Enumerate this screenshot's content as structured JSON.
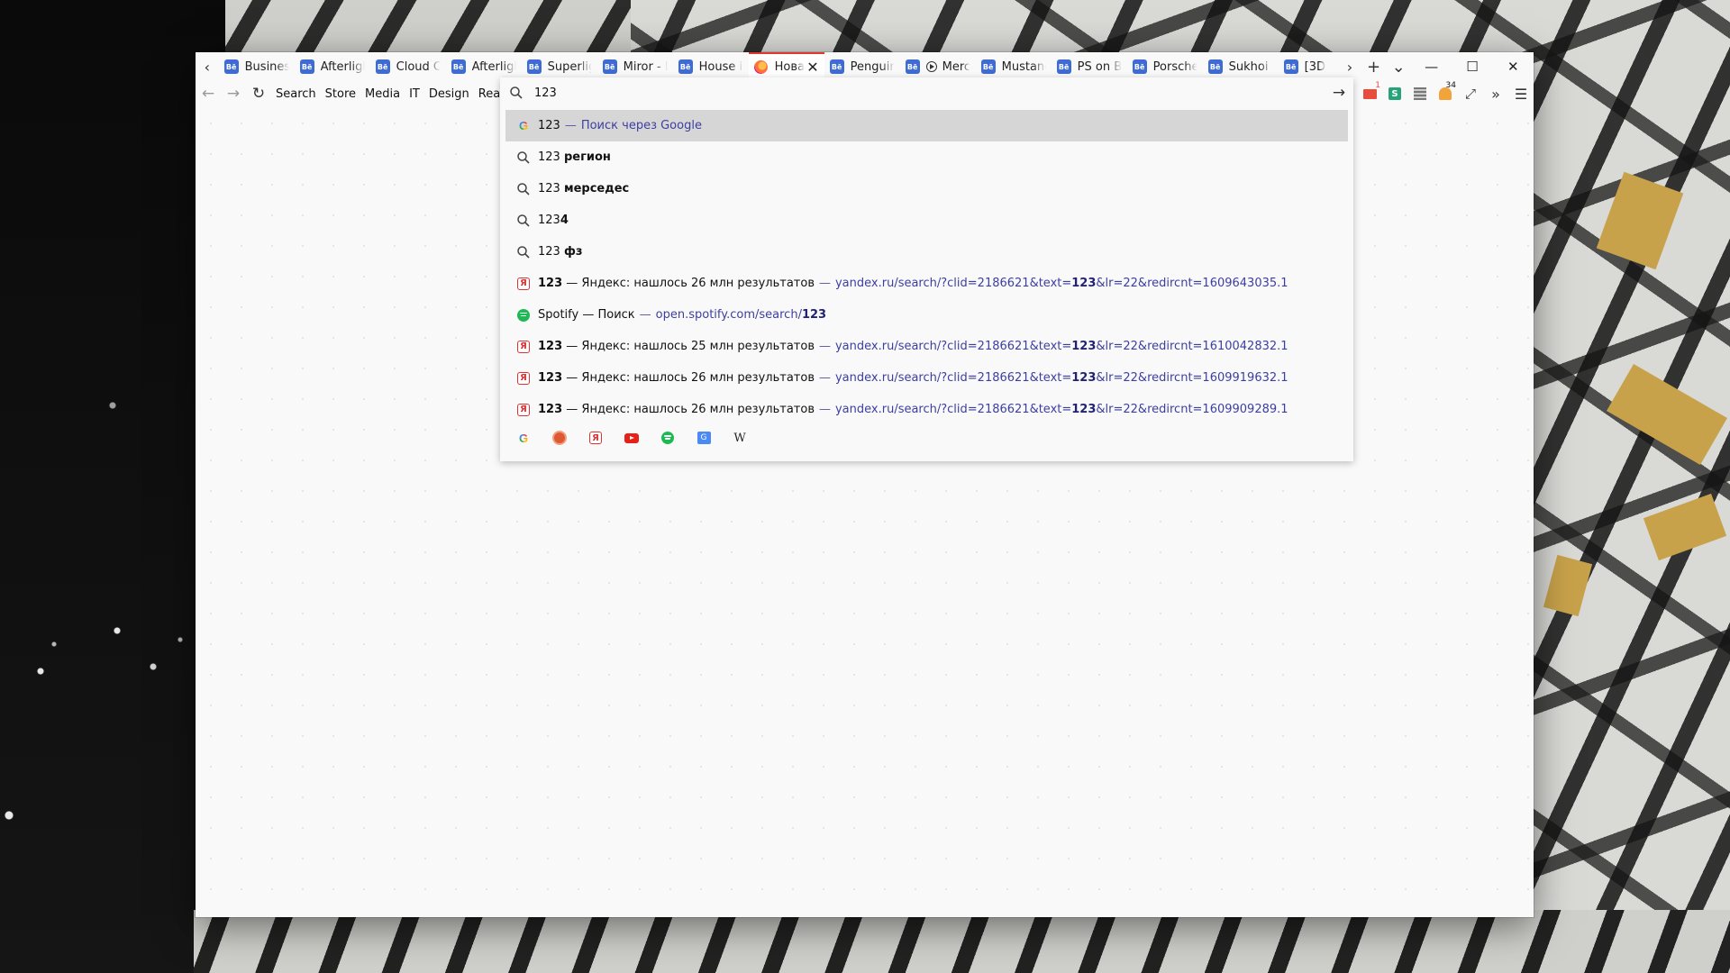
{
  "tabs": [
    {
      "label": "Business",
      "fav": "Bē"
    },
    {
      "label": "Afterlight",
      "fav": "Bē"
    },
    {
      "label": "Cloud Co",
      "fav": "Bē"
    },
    {
      "label": "Afterlight",
      "fav": "Bē"
    },
    {
      "label": "Superlight",
      "fav": "Bē"
    },
    {
      "label": "Miror - D",
      "fav": "Bē"
    },
    {
      "label": "House in",
      "fav": "Bē"
    },
    {
      "label": "Новая",
      "fav": "firefox-icon",
      "active": true
    },
    {
      "label": "Penguin",
      "fav": "Bē"
    },
    {
      "label": "Merce",
      "fav": "Bē",
      "media": true
    },
    {
      "label": "Mustang",
      "fav": "Bē"
    },
    {
      "label": "PS on Be",
      "fav": "Bē"
    },
    {
      "label": "Porsche",
      "fav": "Bē"
    },
    {
      "label": "Sukhoi Su",
      "fav": "Bē"
    },
    {
      "label": "[3D",
      "fav": "Bē"
    }
  ],
  "bookmarks": [
    "Search",
    "Store",
    "Media",
    "IT",
    "Design",
    "Read"
  ],
  "urlbar": {
    "value": "123"
  },
  "results": [
    {
      "icon": "google",
      "text": "123",
      "bold": "",
      "sep": "—",
      "hint": "Поиск через Google",
      "selected": true
    },
    {
      "icon": "search",
      "text": "123 ",
      "bold": "регион"
    },
    {
      "icon": "search",
      "text": "123 ",
      "bold": "мерседес"
    },
    {
      "icon": "search",
      "text": "123",
      "bold": "4"
    },
    {
      "icon": "search",
      "text": "123 ",
      "bold": "фз"
    },
    {
      "icon": "yandex",
      "titleBold": "123",
      "title": " — Яндекс: нашлось 26 млн результатов",
      "sep": "—",
      "urlA": "yandex.ru/search/?clid=2186621&text=",
      "urlB": "123",
      "urlC": "&lr=22&redircnt=1609643035.1"
    },
    {
      "icon": "spotify",
      "titleBold": "",
      "title": "Spotify — Поиск",
      "sep": "—",
      "urlA": "open.spotify.com/search/",
      "urlB": "123",
      "urlC": ""
    },
    {
      "icon": "yandex",
      "titleBold": "123",
      "title": " — Яндекс: нашлось 25 млн результатов",
      "sep": "—",
      "urlA": "yandex.ru/search/?clid=2186621&text=",
      "urlB": "123",
      "urlC": "&lr=22&redircnt=1610042832.1"
    },
    {
      "icon": "yandex",
      "titleBold": "123",
      "title": " — Яндекс: нашлось 26 млн результатов",
      "sep": "—",
      "urlA": "yandex.ru/search/?clid=2186621&text=",
      "urlB": "123",
      "urlC": "&lr=22&redircnt=1609919632.1"
    },
    {
      "icon": "yandex",
      "titleBold": "123",
      "title": " — Яндекс: нашлось 26 млн результатов",
      "sep": "—",
      "urlA": "yandex.ru/search/?clid=2186621&text=",
      "urlB": "123",
      "urlC": "&lr=22&redircnt=1609909289.1"
    }
  ],
  "engines": [
    "google-icon",
    "duckduckgo-icon",
    "yandex-icon",
    "youtube-icon",
    "spotify-icon",
    "translate-icon",
    "wikipedia-icon"
  ],
  "extensions": {
    "mail_badge": "1",
    "notify_badge": "34"
  },
  "colors": {
    "active_tab_accent": "#e0382c",
    "behance_blue": "#3e6bd4",
    "link_color": "#3c3fa0",
    "selected_row": "#d6d6d6"
  }
}
